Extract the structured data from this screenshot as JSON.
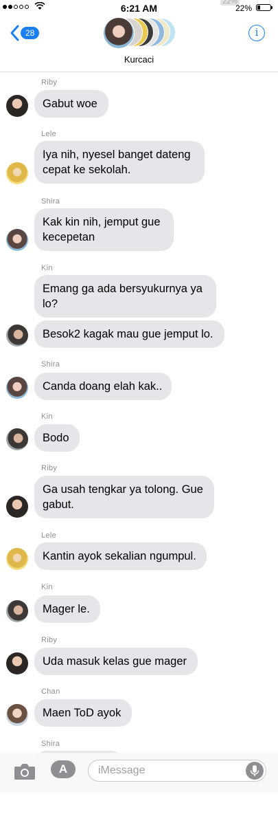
{
  "status_bar": {
    "time": "6:21 AM",
    "battery": "22%",
    "battery_ghost": "22%",
    "battery_level": 0.22
  },
  "header": {
    "back_count": "28",
    "title": "Kurcaci",
    "info_icon": "i"
  },
  "messages": [
    {
      "sender": "Riby",
      "text": "Gabut woe",
      "avatar": "riby"
    },
    {
      "sender": "Lele",
      "text": "Iya nih, nyesel banget dateng cepat ke sekolah.",
      "avatar": "lele"
    },
    {
      "sender": "Shira",
      "text": "Kak kin nih, jemput gue kecepetan",
      "avatar": "shira"
    },
    {
      "sender": "Kin",
      "text": "Emang ga ada bersyukurnya ya lo?",
      "avatar": ""
    },
    {
      "sender": "",
      "text": "Besok2 kagak mau gue jemput lo.",
      "avatar": "kin"
    },
    {
      "sender": "Shira",
      "text": "Canda doang elah kak..",
      "avatar": "shira"
    },
    {
      "sender": "Kin",
      "text": "Bodo",
      "avatar": "kin"
    },
    {
      "sender": "Riby",
      "text": "Ga usah tengkar ya tolong. Gue gabut.",
      "avatar": "riby"
    },
    {
      "sender": "Lele",
      "text": "Kantin ayok sekalian ngumpul.",
      "avatar": "lele"
    },
    {
      "sender": "Kin",
      "text": "Mager le.",
      "avatar": "kin"
    },
    {
      "sender": "Riby",
      "text": "Uda masuk kelas gue mager",
      "avatar": "riby"
    },
    {
      "sender": "Chan",
      "text": "Maen ToD ayok",
      "avatar": "chan"
    },
    {
      "sender": "Shira",
      "text": "",
      "avatar": ""
    }
  ],
  "input": {
    "placeholder": "iMessage",
    "app_icon": "A"
  },
  "colors": {
    "accent": "#1a7ff3",
    "bubble": "#e5e5ea",
    "sender": "#8e8e93"
  }
}
